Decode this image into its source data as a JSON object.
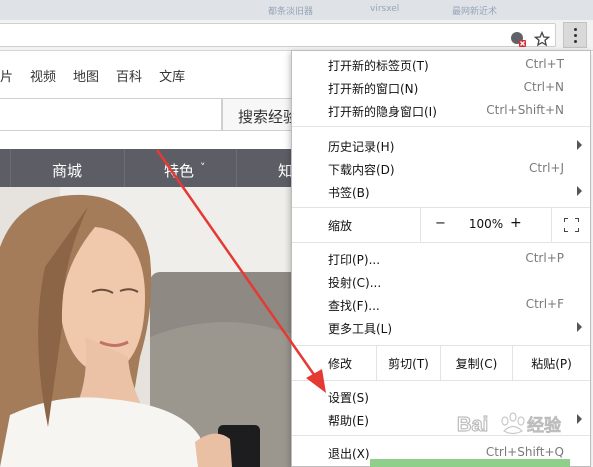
{
  "browser": {
    "tab_strip_blur": [
      "都条淡旧器",
      "virsxel",
      "最网新近术"
    ],
    "omnibox_icons": [
      "adblock-icon",
      "star-icon"
    ],
    "menu_button_icon": "vertical-dots-icon"
  },
  "page": {
    "nav_links": [
      "片",
      "视频",
      "地图",
      "百科",
      "文库"
    ],
    "search_button": "搜索经验",
    "category_bar": [
      "商城",
      "特色",
      "知"
    ],
    "category_chevron": "˅"
  },
  "menu": {
    "new_tab": {
      "label": "打开新的标签页(T)",
      "shortcut": "Ctrl+T"
    },
    "new_window": {
      "label": "打开新的窗口(N)",
      "shortcut": "Ctrl+N"
    },
    "incognito": {
      "label": "打开新的隐身窗口(I)",
      "shortcut": "Ctrl+Shift+N"
    },
    "history": {
      "label": "历史记录(H)"
    },
    "downloads": {
      "label": "下载内容(D)",
      "shortcut": "Ctrl+J"
    },
    "bookmarks": {
      "label": "书签(B)"
    },
    "zoom": {
      "label": "缩放",
      "minus": "−",
      "value": "100%",
      "plus": "+"
    },
    "print": {
      "label": "打印(P)...",
      "shortcut": "Ctrl+P"
    },
    "cast": {
      "label": "投射(C)..."
    },
    "find": {
      "label": "查找(F)...",
      "shortcut": "Ctrl+F"
    },
    "more_tools": {
      "label": "更多工具(L)"
    },
    "edit": {
      "label": "修改",
      "cut": "剪切(T)",
      "copy": "复制(C)",
      "paste": "粘贴(P)"
    },
    "settings": {
      "label": "设置(S)"
    },
    "help": {
      "label": "帮助(E)"
    },
    "exit": {
      "label": "退出(X)",
      "shortcut": "Ctrl+Shift+Q"
    }
  },
  "annotation": {
    "arrow_color": "#e53935",
    "watermark": "Baidu经验"
  }
}
